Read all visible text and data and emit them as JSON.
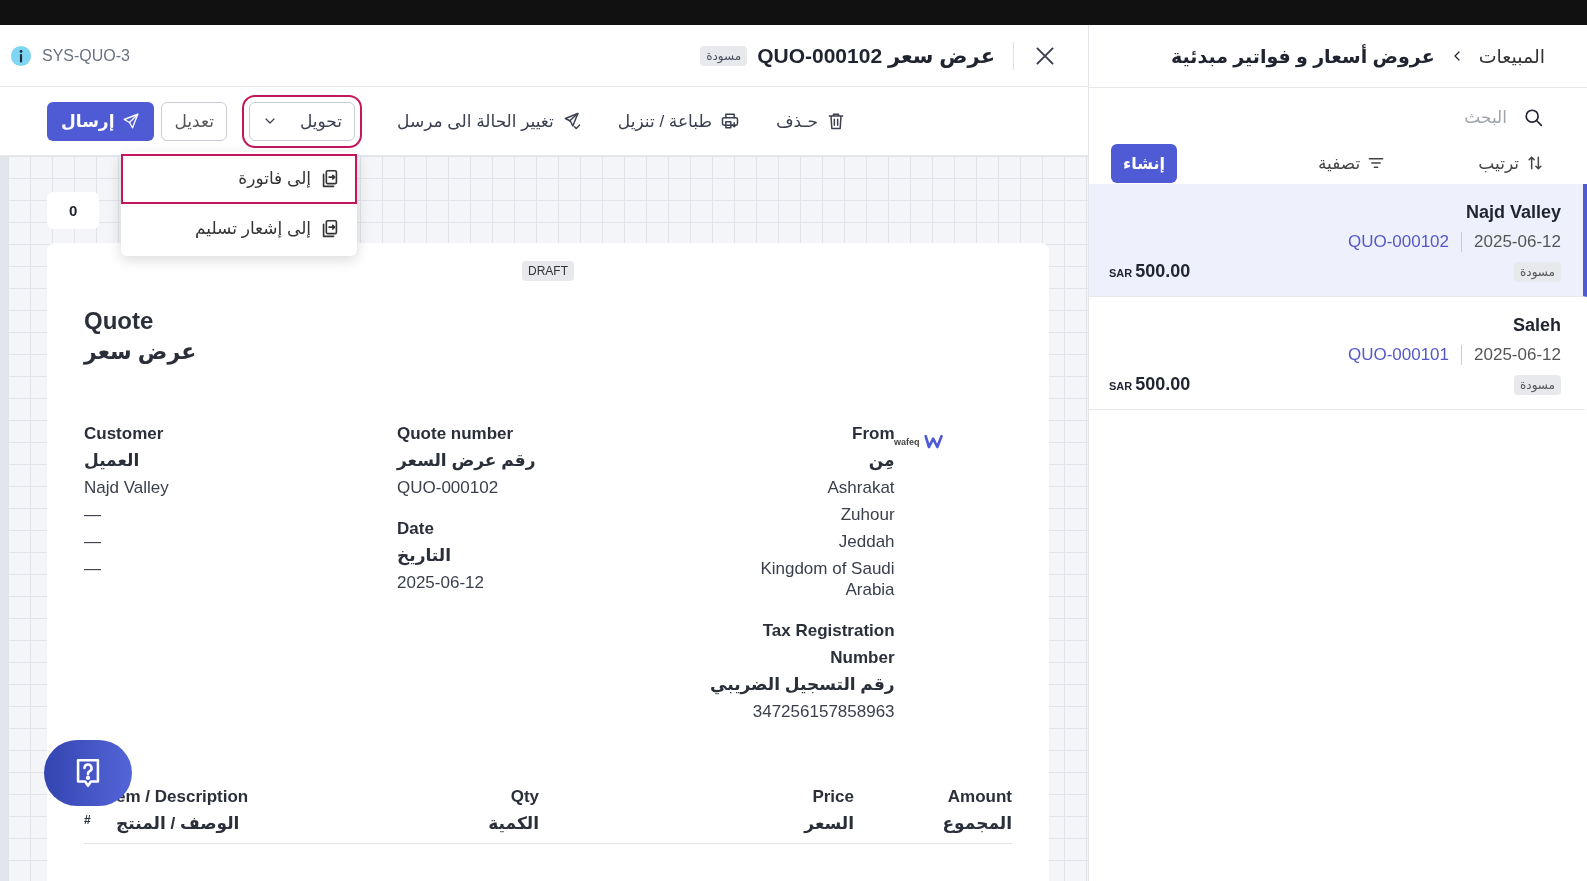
{
  "header": {
    "ref": "SYS-QUO-3",
    "status": "مسودة",
    "title": "عرض سعر QUO-000102"
  },
  "toolbar": [
    {
      "kind": "delete",
      "label": "حـذف"
    },
    {
      "kind": "print",
      "label": "طباعة / تنزيل"
    },
    {
      "kind": "mark-sent",
      "label": "تغيير الحالة الى مرسل"
    },
    {
      "kind": "dropdown",
      "label": "تحويل",
      "expanded": true
    },
    {
      "kind": "outline",
      "label": "تعديل"
    },
    {
      "kind": "primary",
      "label": "إرسال"
    }
  ],
  "convert_menu": [
    {
      "label": "إلى فاتورة",
      "selected": true
    },
    {
      "label": "إلى إشعار تسليم",
      "selected": false
    }
  ],
  "counter_chip": "0",
  "document": {
    "badge": "DRAFT",
    "title": "Quote",
    "title_ar": "عرض سعر",
    "logo_text": "wafeq",
    "customer": {
      "label": "Customer",
      "label_ar": "العميل",
      "lines": [
        "Najd Valley",
        "—",
        "—",
        "—"
      ]
    },
    "quote_number": {
      "label": "Quote number",
      "label_ar": "رقم عرض السعر",
      "value": "QUO-000102"
    },
    "date": {
      "label": "Date",
      "label_ar": "التاريخ",
      "value": "2025-06-12"
    },
    "from": {
      "label": "From",
      "label_ar": "مِن",
      "lines": [
        "Ashrakat",
        "Zuhour",
        "Jeddah",
        "Kingdom of Saudi Arabia"
      ]
    },
    "tax": {
      "label": "Tax Registration Number",
      "label_ar": "رقم التسجيل الضريبي",
      "value": "347256157858963"
    },
    "columns": [
      {
        "label": "Amount",
        "label_ar": "المجموع"
      },
      {
        "label": "Price",
        "label_ar": "السعر"
      },
      {
        "label": "Qty",
        "label_ar": "الكمية"
      },
      {
        "label": "em / Description",
        "label_ar": "الوصف / المنتج"
      },
      {
        "label": "#"
      }
    ]
  },
  "sidebar": {
    "breadcrumb": [
      "المبيعات",
      "عروض أسعار و فواتير مبدئية"
    ],
    "search": {
      "placeholder": "البحث"
    },
    "sort": "ترتيب",
    "filter": "تصفية",
    "create": "إنشاء",
    "quotes": [
      {
        "customer": "Najd Valley",
        "date": "2025-06-12",
        "number": "QUO-000102",
        "status": "مسودة",
        "currency": "SAR",
        "amount": "500.00",
        "selected": true
      },
      {
        "customer": "Saleh",
        "date": "2025-06-12",
        "number": "QUO-000101",
        "status": "مسودة",
        "currency": "SAR",
        "amount": "500.00",
        "selected": false
      }
    ]
  }
}
